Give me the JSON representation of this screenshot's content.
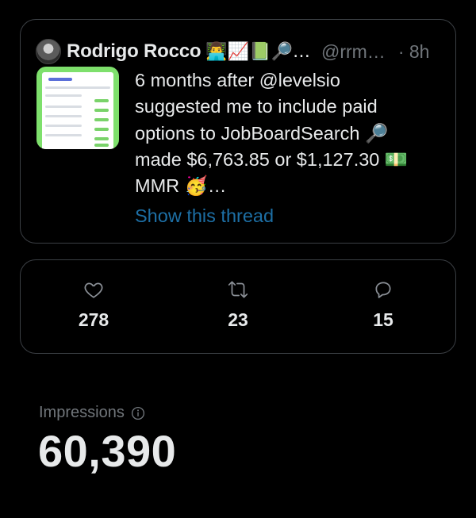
{
  "tweet": {
    "author_name": "Rodrigo Rocco",
    "author_emojis": "👨‍💻📈📗🔎…",
    "handle": "@rrm…",
    "time": "· 8h",
    "text": "6 months after @levelsio\nsuggested me to include paid\noptions to JobBoardSearch 🔎\nmade $6,763.85 or $1,127.30 💵\nMMR 🥳…",
    "show_thread": "Show this thread"
  },
  "stats": {
    "likes": "278",
    "retweets": "23",
    "replies": "15"
  },
  "impressions": {
    "label": "Impressions",
    "value": "60,390"
  },
  "icons": {
    "like": "heart-icon",
    "retweet": "retweet-icon",
    "reply": "reply-icon",
    "info": "info-icon"
  },
  "colors": {
    "background": "#000000",
    "text": "#e7e9ea",
    "muted": "#71767b",
    "link": "#1d6fa5",
    "border": "#3b3f44"
  }
}
